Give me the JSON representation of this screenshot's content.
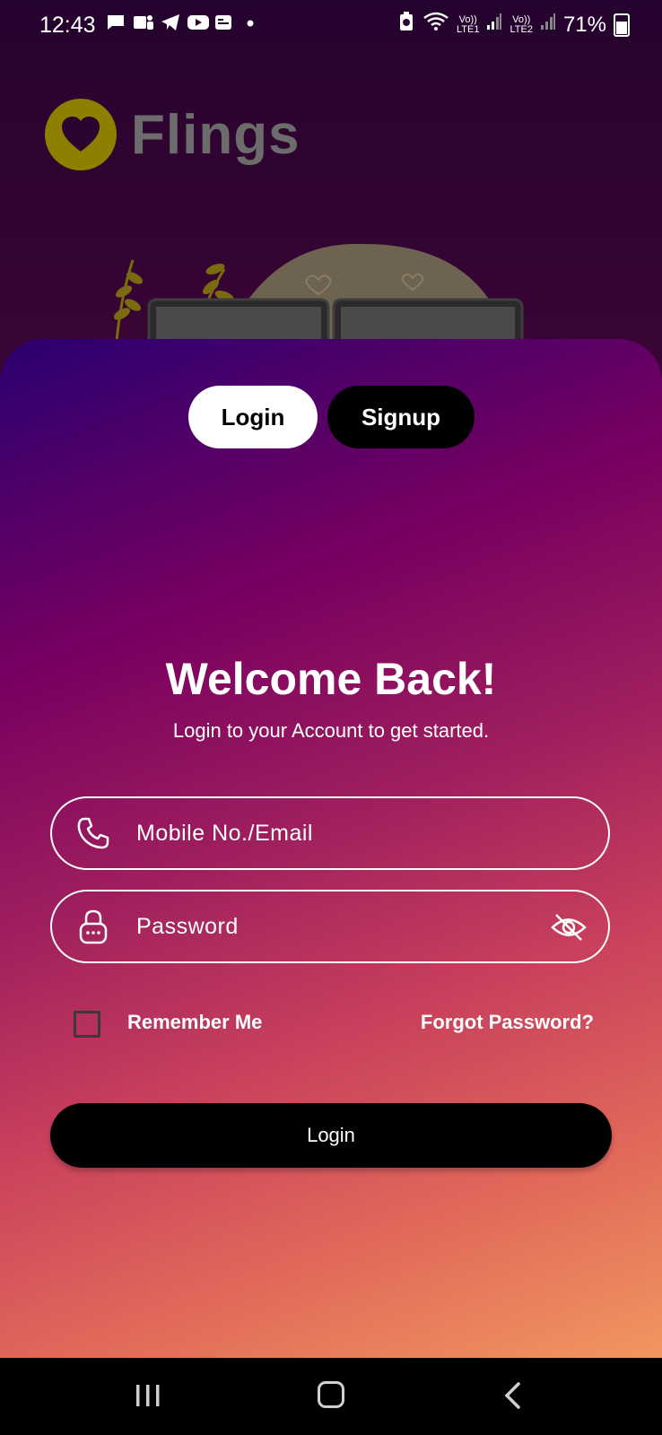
{
  "status_bar": {
    "time": "12:43",
    "battery": "71%",
    "sim1": "LTE1",
    "sim2": "LTE2",
    "volte": "Vo))",
    "icons": [
      "chat-icon",
      "teams-icon",
      "telegram-icon",
      "youtube-icon",
      "news-icon",
      "dot-icon",
      "battery-saver-icon",
      "wifi-icon",
      "signal-icon",
      "signal-icon",
      "battery-icon"
    ]
  },
  "brand": {
    "name": "Flings",
    "logo_color": "#8f7f00"
  },
  "tabs": {
    "login": "Login",
    "signup": "Signup"
  },
  "welcome": {
    "title": "Welcome Back!",
    "subtitle": "Login to your Account to get started."
  },
  "form": {
    "email_placeholder": "Mobile No./Email",
    "password_placeholder": "Password",
    "remember_me": "Remember Me",
    "forgot_password": "Forgot Password?",
    "submit": "Login"
  },
  "colors": {
    "gradient_start": "#2a0070",
    "gradient_mid": "#a0205e",
    "gradient_end": "#f2965f",
    "button": "#000000"
  }
}
